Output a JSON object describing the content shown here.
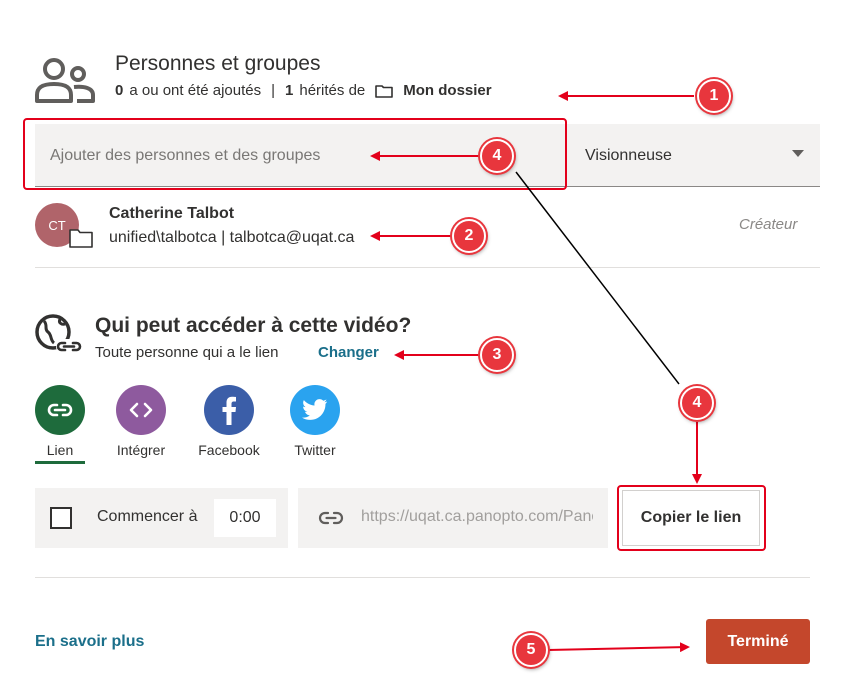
{
  "header": {
    "title": "Personnes et groupes",
    "added_count": "0",
    "added_text": "a ou ont été ajoutés",
    "separator": "|",
    "inherited_count": "1",
    "inherited_text": "hérités de",
    "folder_name": "Mon dossier"
  },
  "add_people": {
    "placeholder": "Ajouter des personnes et des groupes",
    "role": "Visionneuse"
  },
  "person": {
    "initials": "CT",
    "name": "Catherine Talbot",
    "detail": "unified\\talbotca | talbotca@uqat.ca",
    "role": "Créateur"
  },
  "access": {
    "title": "Qui peut accéder à cette vidéo?",
    "subtitle": "Toute personne qui a le lien",
    "change_link": "Changer"
  },
  "share": [
    {
      "label": "Lien",
      "color": "#1e6b3c",
      "icon": "link-icon"
    },
    {
      "label": "Intégrer",
      "color": "#8e5a9e",
      "icon": "code-icon"
    },
    {
      "label": "Facebook",
      "color": "#3b5ea8",
      "icon": "facebook-icon"
    },
    {
      "label": "Twitter",
      "color": "#2aa3ef",
      "icon": "twitter-icon"
    }
  ],
  "start": {
    "label": "Commencer à",
    "time": "0:00"
  },
  "link": {
    "url": "https://uqat.ca.panopto.com/Panopto/Pages/Viewer.aspx",
    "copy_label": "Copier le lien"
  },
  "footer": {
    "learn_more": "En savoir plus",
    "done": "Terminé"
  },
  "annotations": [
    "1",
    "4",
    "2",
    "3",
    "4",
    "5"
  ],
  "colors": {
    "annotation_red": "#e3001b",
    "accent_teal": "#1b6f8a",
    "done_button": "#c4472c"
  }
}
